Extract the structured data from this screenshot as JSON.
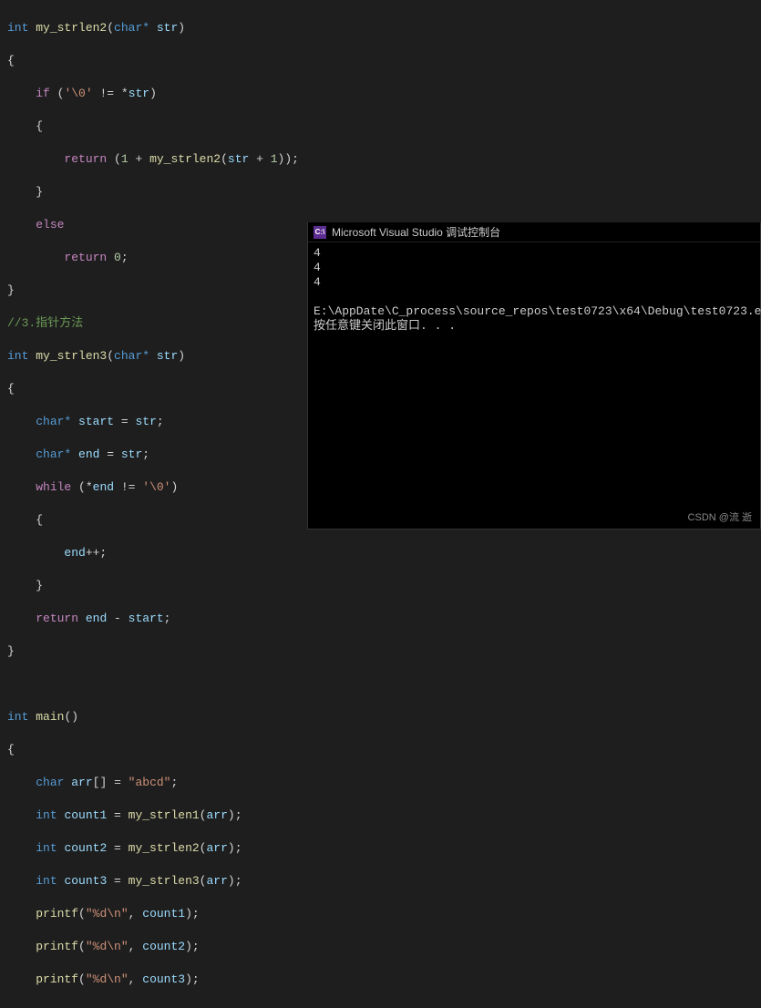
{
  "code": {
    "fn2_sig_ret": "int",
    "fn2_sig_name": "my_strlen2",
    "fn2_sig_param_type": "char*",
    "fn2_sig_param_name": "str",
    "fn2_if_cond_pre": "if (",
    "fn2_if_str1": "'\\0'",
    "fn2_if_op": " != *",
    "fn2_if_var": "str",
    "fn2_if_close": ")",
    "fn2_return": "return",
    "fn2_ret_open": " (",
    "fn2_ret_num": "1",
    "fn2_ret_plus": " + ",
    "fn2_ret_call": "my_strlen2",
    "fn2_ret_paren_open": "(",
    "fn2_ret_arg": "str + ",
    "fn2_ret_arg_num": "1",
    "fn2_ret_close": "));",
    "fn2_else": "else",
    "fn2_return0": "return",
    "fn2_num0": "0",
    "fn2_semi": ";",
    "comment3": "//3.指针方法",
    "fn3_sig_ret": "int",
    "fn3_sig_name": "my_strlen3",
    "fn3_sig_param_type": "char*",
    "fn3_sig_param_name": "str",
    "fn3_start_type": "char*",
    "fn3_start_name": "start",
    "fn3_start_eq": " = ",
    "fn3_start_val": "str",
    "fn3_end_type": "char*",
    "fn3_end_name": "end",
    "fn3_end_eq": " = ",
    "fn3_end_val": "str",
    "fn3_while": "while",
    "fn3_while_open": " (*",
    "fn3_while_var": "end",
    "fn3_while_ne": " != ",
    "fn3_while_str": "'\\0'",
    "fn3_while_close": ")",
    "fn3_inc_var": "end",
    "fn3_inc_op": "++;",
    "fn3_ret": "return",
    "fn3_ret_expr1": "end",
    "fn3_ret_minus": " - ",
    "fn3_ret_expr2": "start",
    "fn3_ret_semi": ";",
    "main_ret": "int",
    "main_name": "main",
    "main_parens": "()",
    "main_arr_type": "char",
    "main_arr_name": "arr",
    "main_arr_brackets": "[]",
    "main_arr_eq": " = ",
    "main_arr_str": "\"abcd\"",
    "main_c1_type": "int",
    "main_c1_name": "count1",
    "main_c1_eq": " = ",
    "main_c1_fn": "my_strlen1",
    "main_c1_arg": "arr",
    "main_c2_type": "int",
    "main_c2_name": "count2",
    "main_c2_eq": " = ",
    "main_c2_fn": "my_strlen2",
    "main_c2_arg": "arr",
    "main_c3_type": "int",
    "main_c3_name": "count3",
    "main_c3_eq": " = ",
    "main_c3_fn": "my_strlen3",
    "main_c3_arg": "arr",
    "main_p1_fn": "printf",
    "main_p1_str": "\"%d\\n\"",
    "main_p1_comma": ", ",
    "main_p1_arg": "count1",
    "main_p2_fn": "printf",
    "main_p2_str": "\"%d\\n\"",
    "main_p2_comma": ", ",
    "main_p2_arg": "count2",
    "main_p3_fn": "printf",
    "main_p3_str": "\"%d\\n\"",
    "main_p3_comma": ", ",
    "main_p3_arg": "count3",
    "paren_open": "(",
    "paren_close": ")",
    "brace_open": "{",
    "brace_close": "}",
    "semi": ";"
  },
  "console": {
    "icon_text": "C:\\",
    "title": "Microsoft Visual Studio 调试控制台",
    "out1": "4",
    "out2": "4",
    "out3": "4",
    "blank": "",
    "path": "E:\\AppDate\\C_process\\source_repos\\test0723\\x64\\Debug\\test0723.e",
    "prompt": "按任意键关闭此窗口. . ."
  },
  "watermark": "CSDN @流 逝"
}
